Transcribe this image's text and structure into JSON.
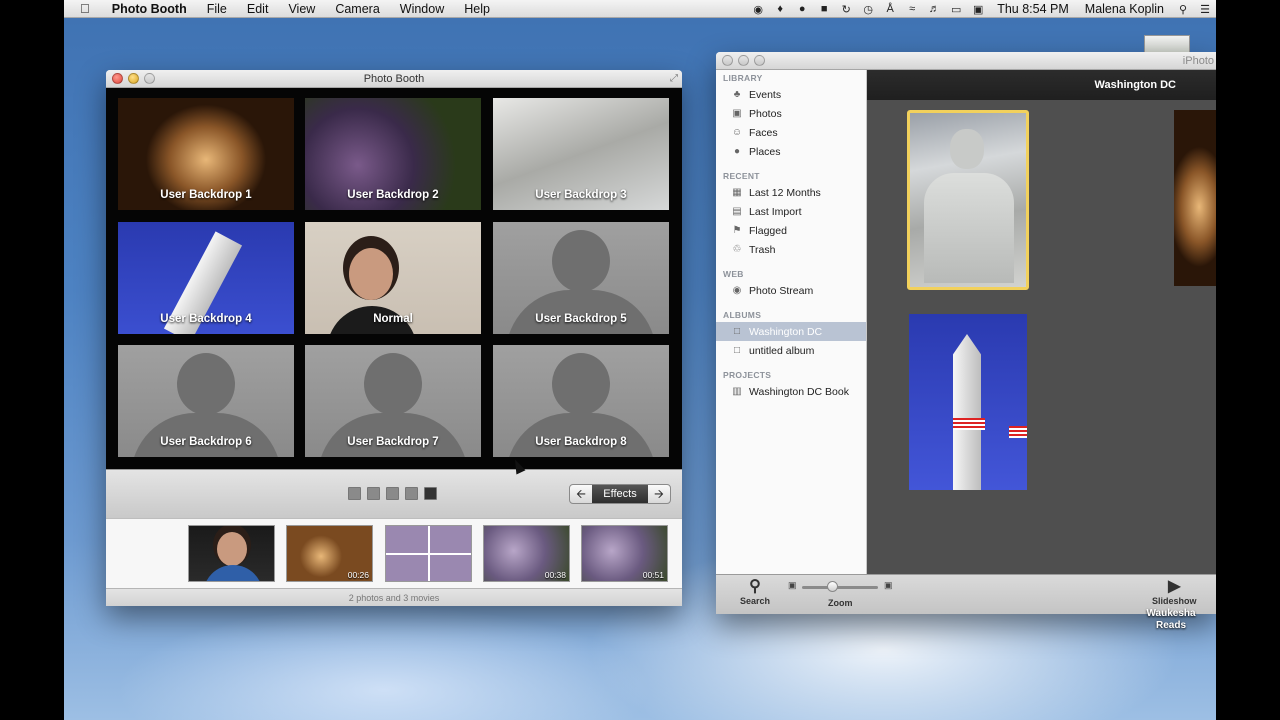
{
  "menubar": {
    "apple": "",
    "app_name": "Photo Booth",
    "menus": [
      "File",
      "Edit",
      "View",
      "Camera",
      "Window",
      "Help"
    ],
    "clock": "Thu 8:54 PM",
    "user": "Malena Koplin"
  },
  "photo_booth": {
    "title": "Photo Booth",
    "tiles": [
      {
        "label": "User Backdrop 1",
        "style": "lincoln"
      },
      {
        "label": "User Backdrop 2",
        "style": "grapes"
      },
      {
        "label": "User Backdrop 3",
        "style": "mlk"
      },
      {
        "label": "User Backdrop 4",
        "style": "wash"
      },
      {
        "label": "Normal",
        "style": "normal"
      },
      {
        "label": "User Backdrop 5",
        "style": "sil"
      },
      {
        "label": "User Backdrop 6",
        "style": "sil"
      },
      {
        "label": "User Backdrop 7",
        "style": "sil"
      },
      {
        "label": "User Backdrop 8",
        "style": "sil"
      }
    ],
    "page_count": 5,
    "active_page": 5,
    "effects_label": "Effects",
    "thumbnails": [
      {
        "duration": "",
        "style": "person"
      },
      {
        "duration": "00:26",
        "style": "lincoln"
      },
      {
        "duration": "",
        "style": "grid"
      },
      {
        "duration": "00:38",
        "style": "grapes"
      },
      {
        "duration": "00:51",
        "style": "grapes"
      }
    ],
    "status": "2 photos and 3 movies"
  },
  "iphoto": {
    "title": "iPhoto",
    "album_title": "Washington DC",
    "sections": [
      {
        "heading": "LIBRARY",
        "items": [
          {
            "label": "Events",
            "icon": "palm-tree-icon"
          },
          {
            "label": "Photos",
            "icon": "photos-icon"
          },
          {
            "label": "Faces",
            "icon": "person-icon"
          },
          {
            "label": "Places",
            "icon": "globe-icon"
          }
        ]
      },
      {
        "heading": "RECENT",
        "items": [
          {
            "label": "Last 12 Months",
            "icon": "calendar-icon"
          },
          {
            "label": "Last Import",
            "icon": "import-icon"
          },
          {
            "label": "Flagged",
            "icon": "flag-icon"
          },
          {
            "label": "Trash",
            "icon": "trash-icon"
          }
        ]
      },
      {
        "heading": "WEB",
        "items": [
          {
            "label": "Photo Stream",
            "icon": "photo-stream-icon"
          }
        ]
      },
      {
        "heading": "ALBUMS",
        "items": [
          {
            "label": "Washington DC",
            "icon": "album-icon",
            "selected": true
          },
          {
            "label": "untitled album",
            "icon": "album-icon"
          }
        ]
      },
      {
        "heading": "PROJECTS",
        "items": [
          {
            "label": "Washington DC Book",
            "icon": "book-icon"
          }
        ]
      }
    ],
    "toolbar": {
      "search_label": "Search",
      "zoom_label": "Zoom",
      "slideshow_label": "Slideshow"
    },
    "zoom_level": 0.4
  },
  "desktop": {
    "icon_label": "Waukesha Reads"
  },
  "colors": {
    "selection_border": "#f2d15c",
    "source_selected": "#b9c3d3"
  }
}
